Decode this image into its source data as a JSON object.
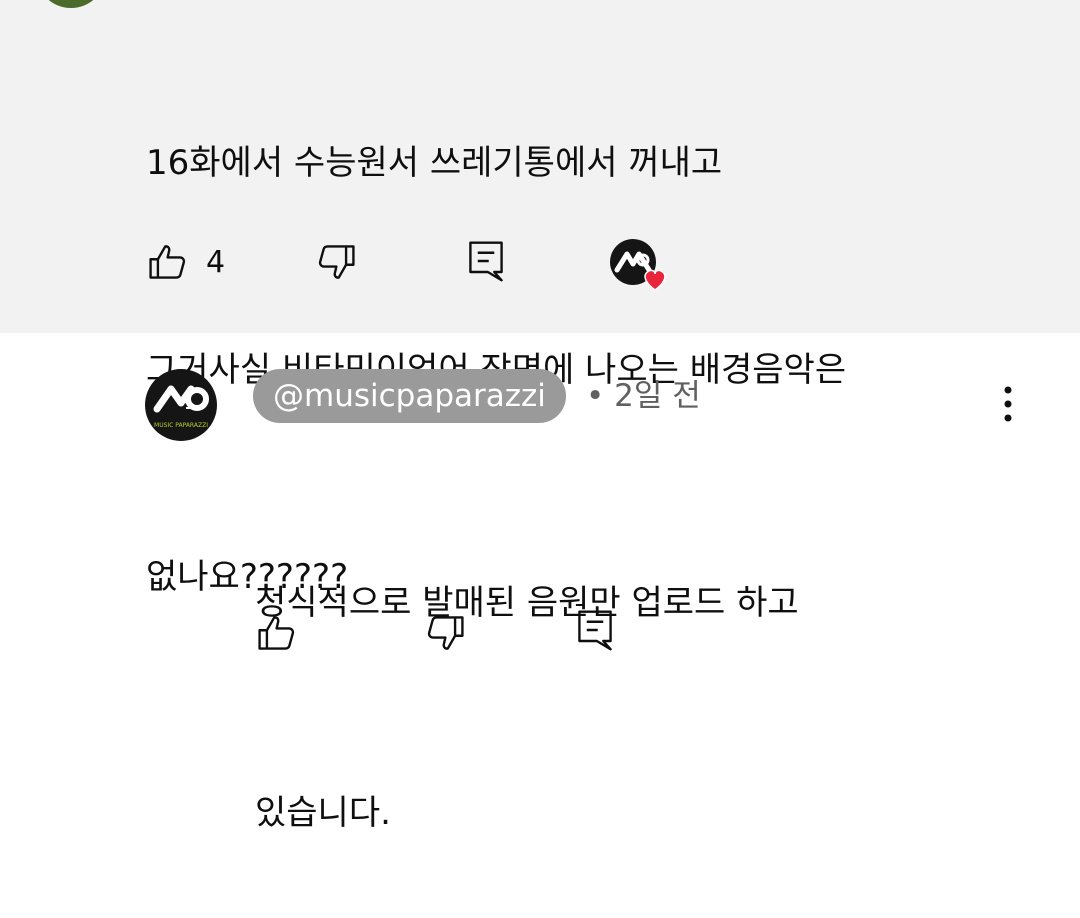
{
  "comment": {
    "lines": [
      "16화에서 수능원서 쓰레기통에서 꺼내고",
      "그거사실 비타민이었어 장면에 나오는 배경음악은",
      "없나요??????"
    ],
    "like_count": "4"
  },
  "reply": {
    "handle": "@musicpaparazzi",
    "meta": "• 2일 전",
    "lines": [
      "정식적으로 발매된 음원만 업로드 하고",
      "있습니다."
    ],
    "avatar_logo_text": "MUSIC PAPARAZZI"
  },
  "colors": {
    "top_background": "#f2f2f2",
    "handle_pill": "#9a9a9a",
    "heart": "#e8253b",
    "avatar_accent": "#b6d12c"
  },
  "icons": {
    "like": "thumb-up-icon",
    "dislike": "thumb-down-icon",
    "reply": "comment-icon",
    "creator_heart": "creator-heart-icon",
    "more": "more-vert-icon"
  }
}
